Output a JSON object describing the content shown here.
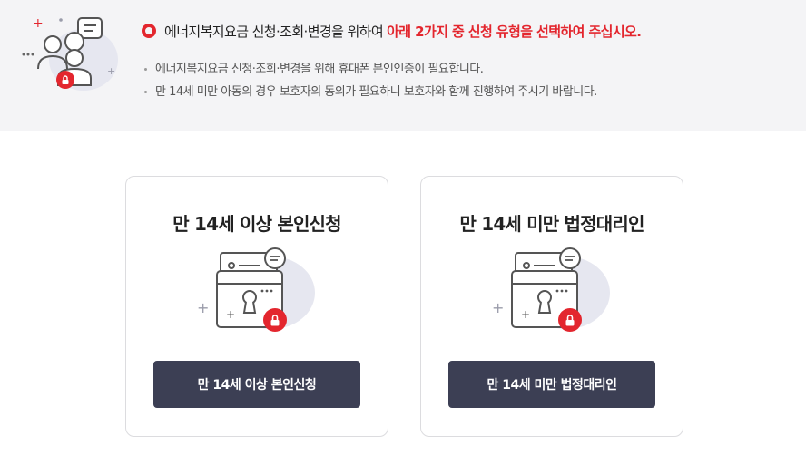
{
  "notice": {
    "title_normal": "에너지복지요금 신청·조회·변경을 위하여",
    "title_highlight": "아래 2가지 중 신청 유형을 선택하여 주십시오.",
    "bullets": [
      "에너지복지요금 신청·조회·변경을 위해 휴대폰 본인인증이 필요합니다.",
      "만 14세 미만 아동의 경우 보호자의 동의가 필요하니 보호자와 함께 진행하여 주시기 바랍니다."
    ]
  },
  "options": [
    {
      "title": "만 14세 이상 본인신청",
      "button_label": "만 14세 이상 본인신청"
    },
    {
      "title": "만 14세 미만 법정대리인",
      "button_label": "만 14세 미만 법정대리인"
    }
  ],
  "colors": {
    "accent": "#e3262e",
    "button": "#3c3f54",
    "notice_bg": "#f4f4f6"
  }
}
